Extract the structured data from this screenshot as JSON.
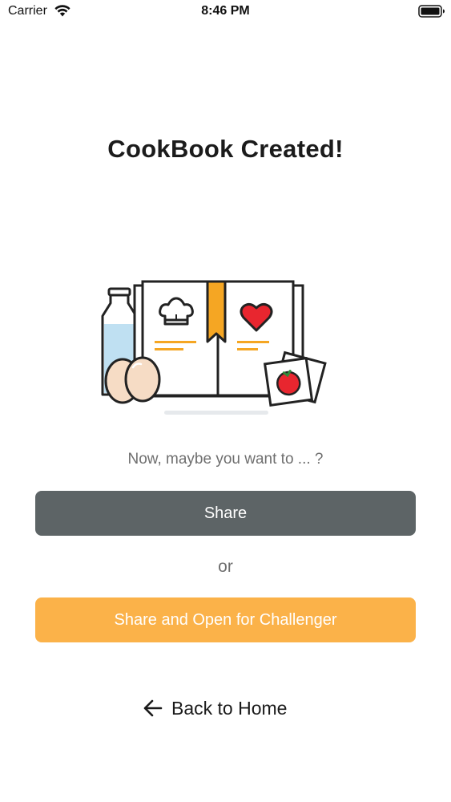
{
  "status_bar": {
    "carrier": "Carrier",
    "time": "8:46 PM",
    "icons": [
      "wifi-icon",
      "battery-icon"
    ]
  },
  "main": {
    "title": "CookBook Created!",
    "illustration": "cookbook-illustration",
    "prompt": "Now, maybe you want to ... ?",
    "share_label": "Share",
    "or_label": "or",
    "challenger_label": "Share and Open for Challenger",
    "back_label": "Back to Home",
    "back_icon": "arrow-left-icon"
  },
  "colors": {
    "share_button": "#5d6466",
    "challenger_button": "#fbb249",
    "illustration_accent": "#f5a623",
    "heart": "#e8262f"
  }
}
